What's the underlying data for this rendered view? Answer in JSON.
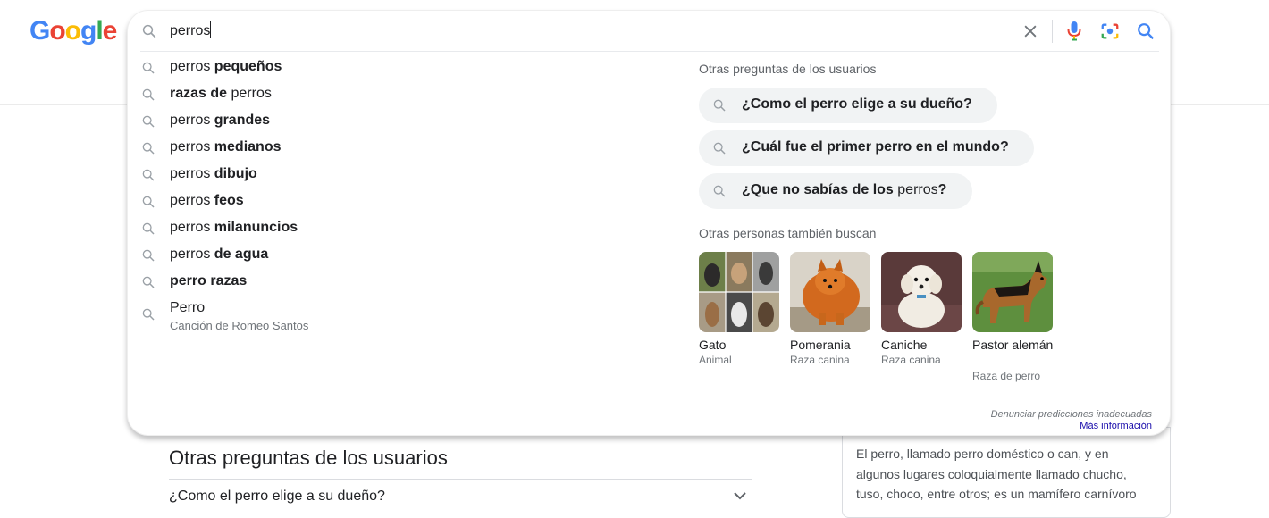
{
  "logo": {
    "letters": [
      "G",
      "o",
      "o",
      "g",
      "l",
      "e"
    ],
    "colors": [
      "#4285F4",
      "#EA4335",
      "#FBBC05",
      "#4285F4",
      "#34A853",
      "#EA4335"
    ]
  },
  "search": {
    "query": "perros"
  },
  "icons": {
    "clear": "close-icon",
    "mic": "microphone-icon",
    "lens": "camera-lens-icon",
    "submit": "search-icon",
    "suggestion": "search-icon"
  },
  "suggestions": [
    {
      "plain": "perros ",
      "bold": "pequeños"
    },
    {
      "bold": "razas de ",
      "plain": "perros"
    },
    {
      "plain": "perros ",
      "bold": "grandes"
    },
    {
      "plain": "perros ",
      "bold": "medianos"
    },
    {
      "plain": "perros ",
      "bold": "dibujo"
    },
    {
      "plain": "perros ",
      "bold": "feos"
    },
    {
      "plain": "perros ",
      "bold": "milanuncios"
    },
    {
      "plain": "perros ",
      "bold": "de agua"
    },
    {
      "bold": "perro razas",
      "plain": ""
    },
    {
      "plain": "Perro",
      "bold": "",
      "sub": "Canción de Romeo Santos"
    }
  ],
  "people_ask": {
    "title": "Otras preguntas de los usuarios",
    "questions": [
      {
        "bold": "¿Como el perro elige a su dueño?",
        "normal": "",
        "tail": ""
      },
      {
        "bold": "¿Cuál fue el primer perro en el mundo?",
        "normal": "",
        "tail": ""
      },
      {
        "bold": "¿Que no sabías de los ",
        "normal": "perros",
        "tail": "?"
      }
    ]
  },
  "related": {
    "title": "Otras personas también buscan",
    "items": [
      {
        "name": "Gato",
        "sub": "Animal"
      },
      {
        "name": "Pomerania",
        "sub": "Raza canina"
      },
      {
        "name": "Caniche",
        "sub": "Raza canina"
      },
      {
        "name": "Pastor alemán",
        "sub": "Raza de perro"
      }
    ]
  },
  "footer": {
    "report": "Denunciar predicciones inadecuadas",
    "more": "Más información"
  },
  "background": {
    "heading": "Otras preguntas de los usuarios",
    "question": "¿Como el perro elige a su dueño?",
    "knowledge_text": "El perro,  llamado perro doméstico o can,  y en algunos lugares coloquialmente llamado chucho, tuso,  choco,  entre otros; es un mamífero carnívoro"
  }
}
